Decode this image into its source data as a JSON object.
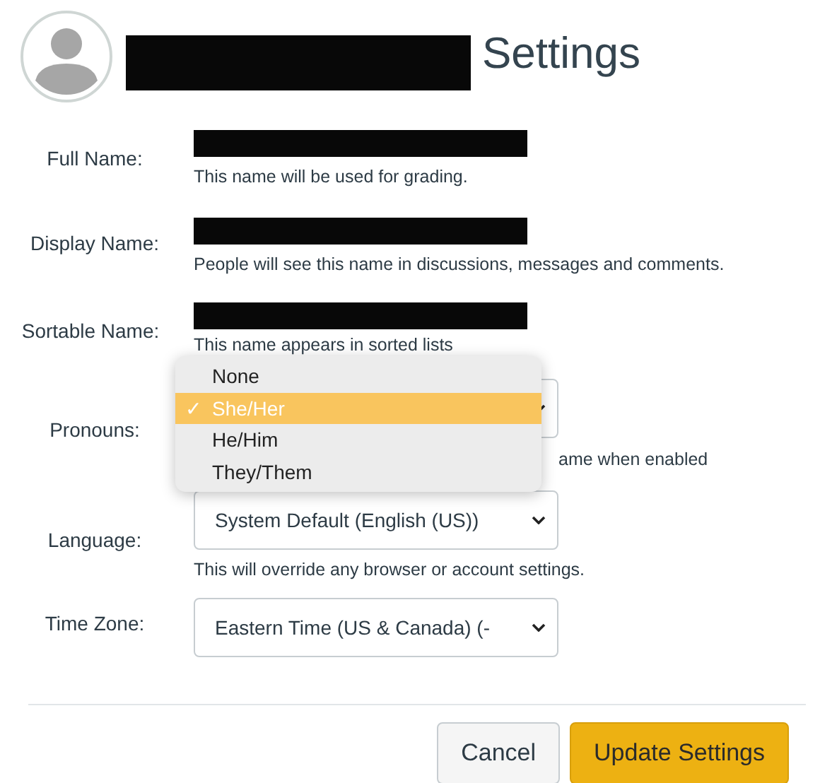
{
  "header": {
    "title": "Settings"
  },
  "fields": [
    {
      "kind": "text",
      "label": "Full Name:",
      "hint": "This name will be used for grading."
    },
    {
      "kind": "text",
      "label": "Display Name:",
      "hint": "People will see this name in discussions, messages and comments."
    },
    {
      "kind": "text",
      "label": "Sortable Name:",
      "hint": "This name appears in sorted lists"
    },
    {
      "kind": "select",
      "label": "Pronouns:",
      "hint": "ame when enabled"
    },
    {
      "kind": "select",
      "label": "Language:",
      "value": "System Default (English (US))",
      "hint": "This will override any browser or account settings."
    },
    {
      "kind": "select",
      "label": "Time Zone:",
      "value": "Eastern Time (US & Canada) (-"
    }
  ],
  "dropdown": {
    "check_mark": "✓",
    "options": [
      {
        "label": "None",
        "selected": false
      },
      {
        "label": "She/Her",
        "selected": true
      },
      {
        "label": "He/Him",
        "selected": false
      },
      {
        "label": "They/Them",
        "selected": false
      }
    ]
  },
  "buttons": [
    {
      "kind": "secondary",
      "label": "Cancel"
    },
    {
      "kind": "primary",
      "label": "Update Settings"
    }
  ]
}
